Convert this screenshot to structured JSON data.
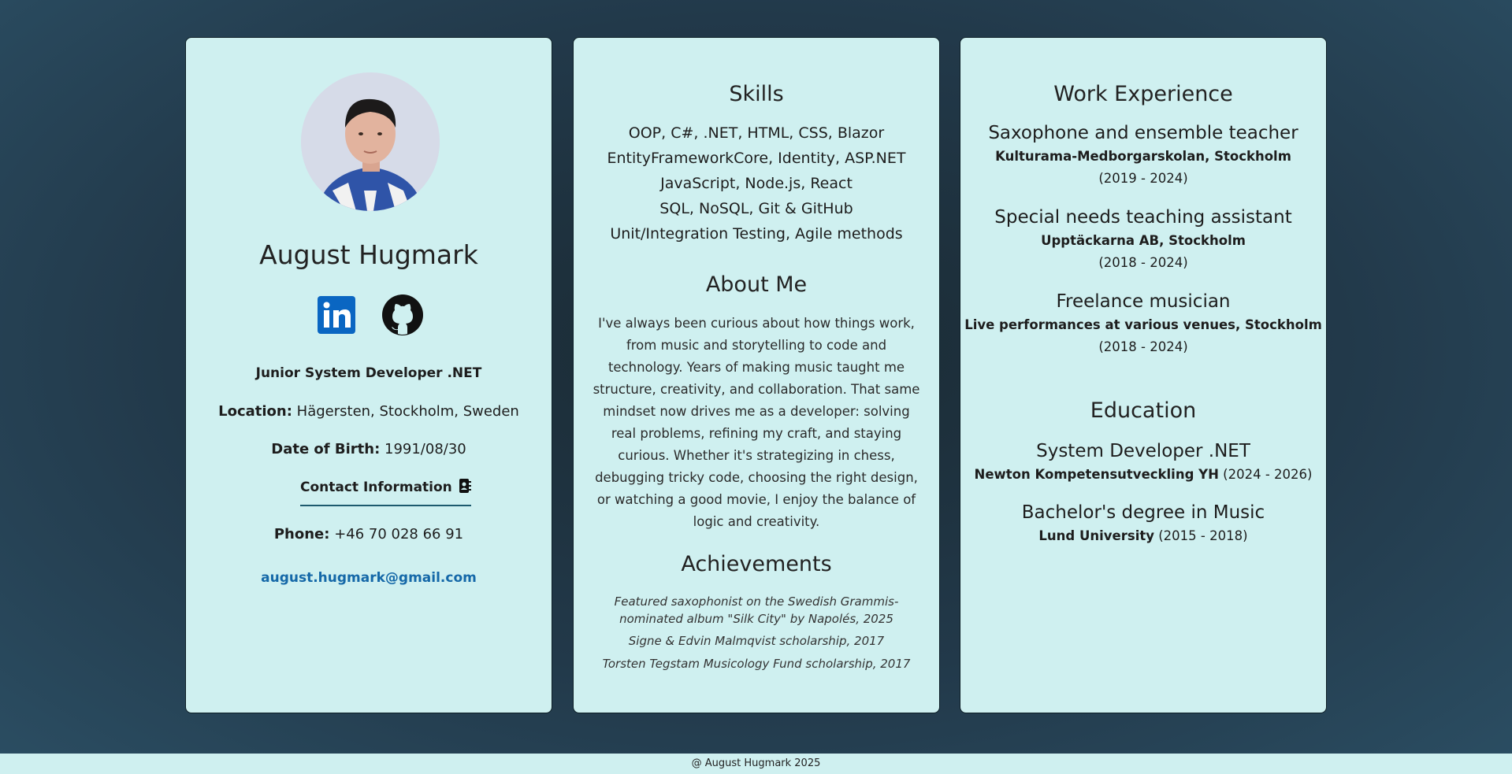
{
  "profile": {
    "name": "August Hugmark",
    "role": "Junior System Developer .NET",
    "location_label": "Location:",
    "location": "Hägersten, Stockholm, Sweden",
    "dob_label": "Date of Birth:",
    "dob": "1991/08/30",
    "contact_heading": "Contact Information",
    "phone_label": "Phone:",
    "phone": "+46 70 028 66 91",
    "email": "august.hugmark@gmail.com",
    "icons": [
      "linkedin-icon",
      "github-icon",
      "contact-card-icon"
    ]
  },
  "skills": {
    "heading": "Skills",
    "items": [
      "OOP, C#, .NET, HTML, CSS, Blazor",
      "EntityFrameworkCore, Identity, ASP.NET",
      "JavaScript, Node.js, React",
      "SQL, NoSQL, Git & GitHub",
      "Unit/Integration Testing, Agile methods"
    ]
  },
  "about": {
    "heading": "About Me",
    "text": "I've always been curious about how things work, from music and storytelling to code and technology. Years of making music taught me structure, creativity, and collaboration. That same mindset now drives me as a developer: solving real problems, refining my craft, and staying curious. Whether it's strategizing in chess, debugging tricky code, choosing the right design, or watching a good movie, I enjoy the balance of logic and creativity."
  },
  "achievements": {
    "heading": "Achievements",
    "items": [
      "Featured saxophonist on the Swedish Grammis-nominated album \"Silk City\" by Napolés, 2025",
      "Signe & Edvin Malmqvist scholarship, 2017",
      "Torsten Tegstam Musicology Fund scholarship, 2017"
    ]
  },
  "work": {
    "heading": "Work Experience",
    "jobs": [
      {
        "title": "Saxophone and ensemble teacher",
        "company": "Kulturama-Medborgarskolan, Stockholm",
        "dates": "(2019 - 2024)"
      },
      {
        "title": "Special needs teaching assistant",
        "company": "Upptäckarna AB, Stockholm",
        "dates": "(2018 - 2024)"
      },
      {
        "title": "Freelance musician",
        "company": "Live performances at various venues, Stockholm",
        "dates": "(2018 - 2024)"
      }
    ]
  },
  "education": {
    "heading": "Education",
    "items": [
      {
        "degree": "System Developer .NET",
        "school": "Newton Kompetensutveckling YH",
        "dates": "(2024 - 2026)"
      },
      {
        "degree": "Bachelor's degree in Music",
        "school": "Lund University",
        "dates": "(2015 - 2018)"
      }
    ]
  },
  "footer": "@ August Hugmark 2025",
  "colors": {
    "card": "#cff0f0",
    "link": "#1568a8",
    "linkedin": "#0a66c2",
    "accent_line": "#1d5a6e"
  }
}
